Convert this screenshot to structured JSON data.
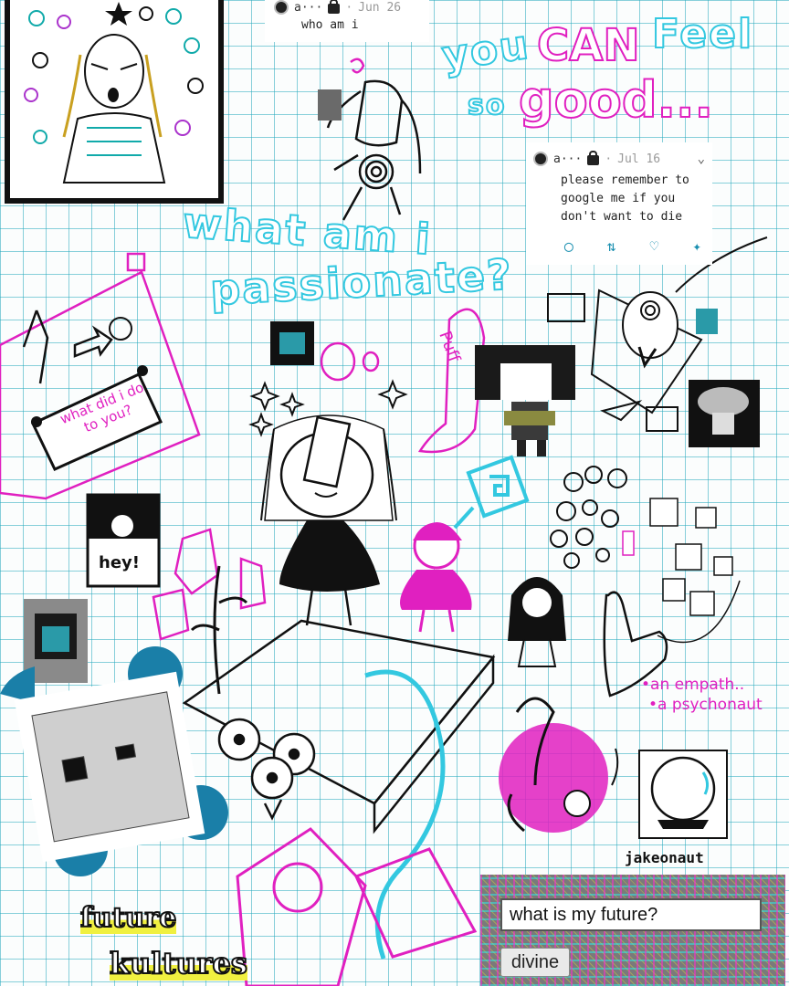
{
  "tweets": [
    {
      "author": "a···",
      "separator": "·",
      "date": "Jun 26",
      "text": "who am i"
    },
    {
      "author": "a···",
      "separator": "·",
      "date": "Jul 16",
      "text": "please remember to google me if you don't want to die"
    }
  ],
  "doodle_text": {
    "slogan_1": "you",
    "slogan_can": "CAN",
    "slogan_feel": "Feel",
    "slogan_so": "so",
    "slogan_good": "good...",
    "passion_1": "what am i",
    "passion_2": "passionate?",
    "banner": "what did i do to you?",
    "hey": "hey!",
    "puff": "Puff",
    "empath": "•an empath..",
    "psychonaut": "•a psychonaut",
    "future_kultures_1": "future",
    "future_kultures_2": "kultures"
  },
  "profile": {
    "username": "jakeonaut"
  },
  "divine": {
    "input_value": "what is my future?",
    "button_label": "divine"
  },
  "colors": {
    "grid": "#28aabe",
    "cyan_ink": "#33c8e0",
    "pink_ink": "#e020c0",
    "link_blue": "#1a8fb0"
  }
}
